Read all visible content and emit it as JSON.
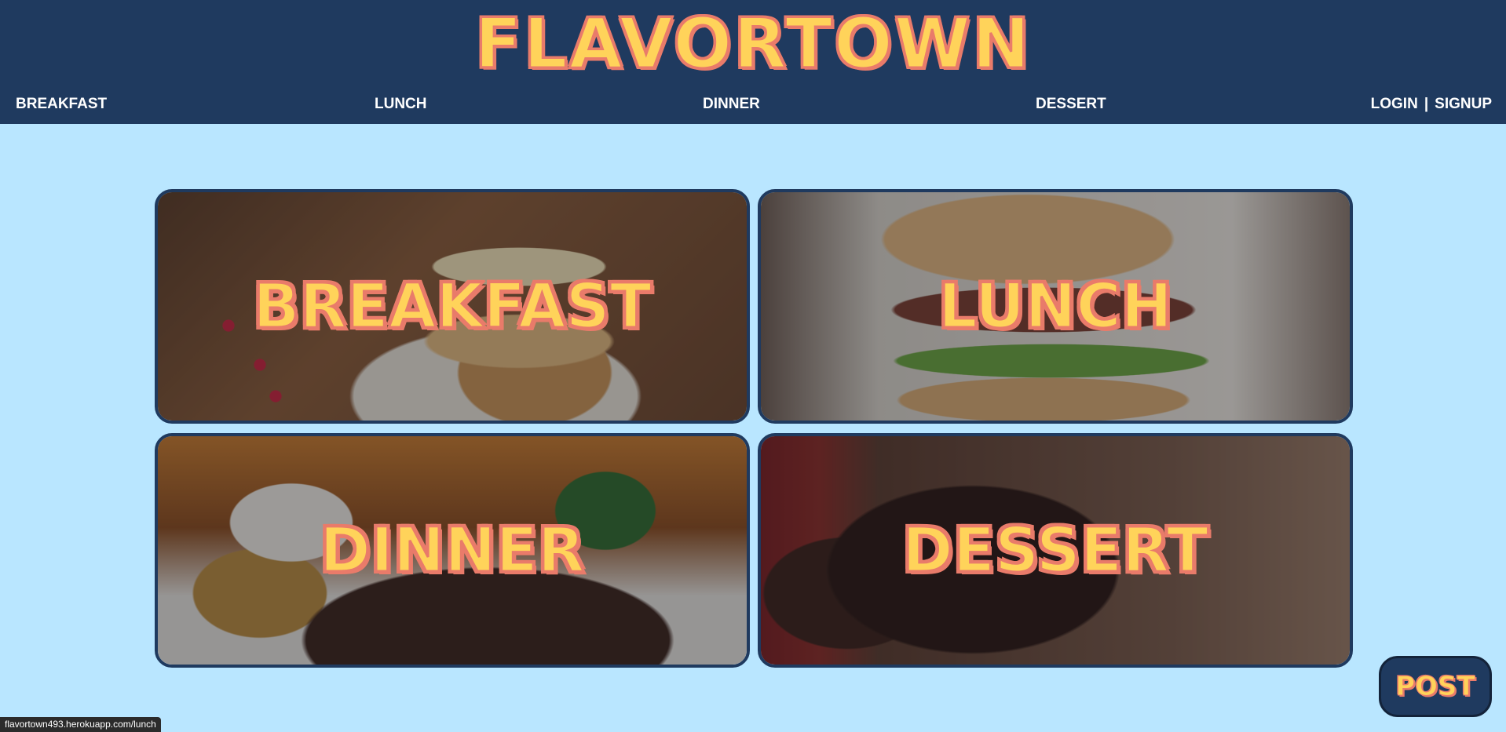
{
  "header": {
    "logo": "FLAVORTOWN",
    "nav": [
      "BREAKFAST",
      "LUNCH",
      "DINNER",
      "DESSERT"
    ],
    "login": "LOGIN",
    "separator": "|",
    "signup": "SIGNUP"
  },
  "categories": [
    {
      "label": "BREAKFAST",
      "image": "pancakes-photo"
    },
    {
      "label": "LUNCH",
      "image": "sandwich-photo"
    },
    {
      "label": "DINNER",
      "image": "steak-photo"
    },
    {
      "label": "DESSERT",
      "image": "chocolate-cake-photo"
    }
  ],
  "post_button": "POST",
  "status_bar": {
    "url": "flavortown493.herokuapp.com/lunch"
  },
  "colors": {
    "page_bg": "#b9e6ff",
    "header_bg": "#1f3a5f",
    "logo_fill": "#ffd35a",
    "logo_outline": "#e97b6a"
  }
}
